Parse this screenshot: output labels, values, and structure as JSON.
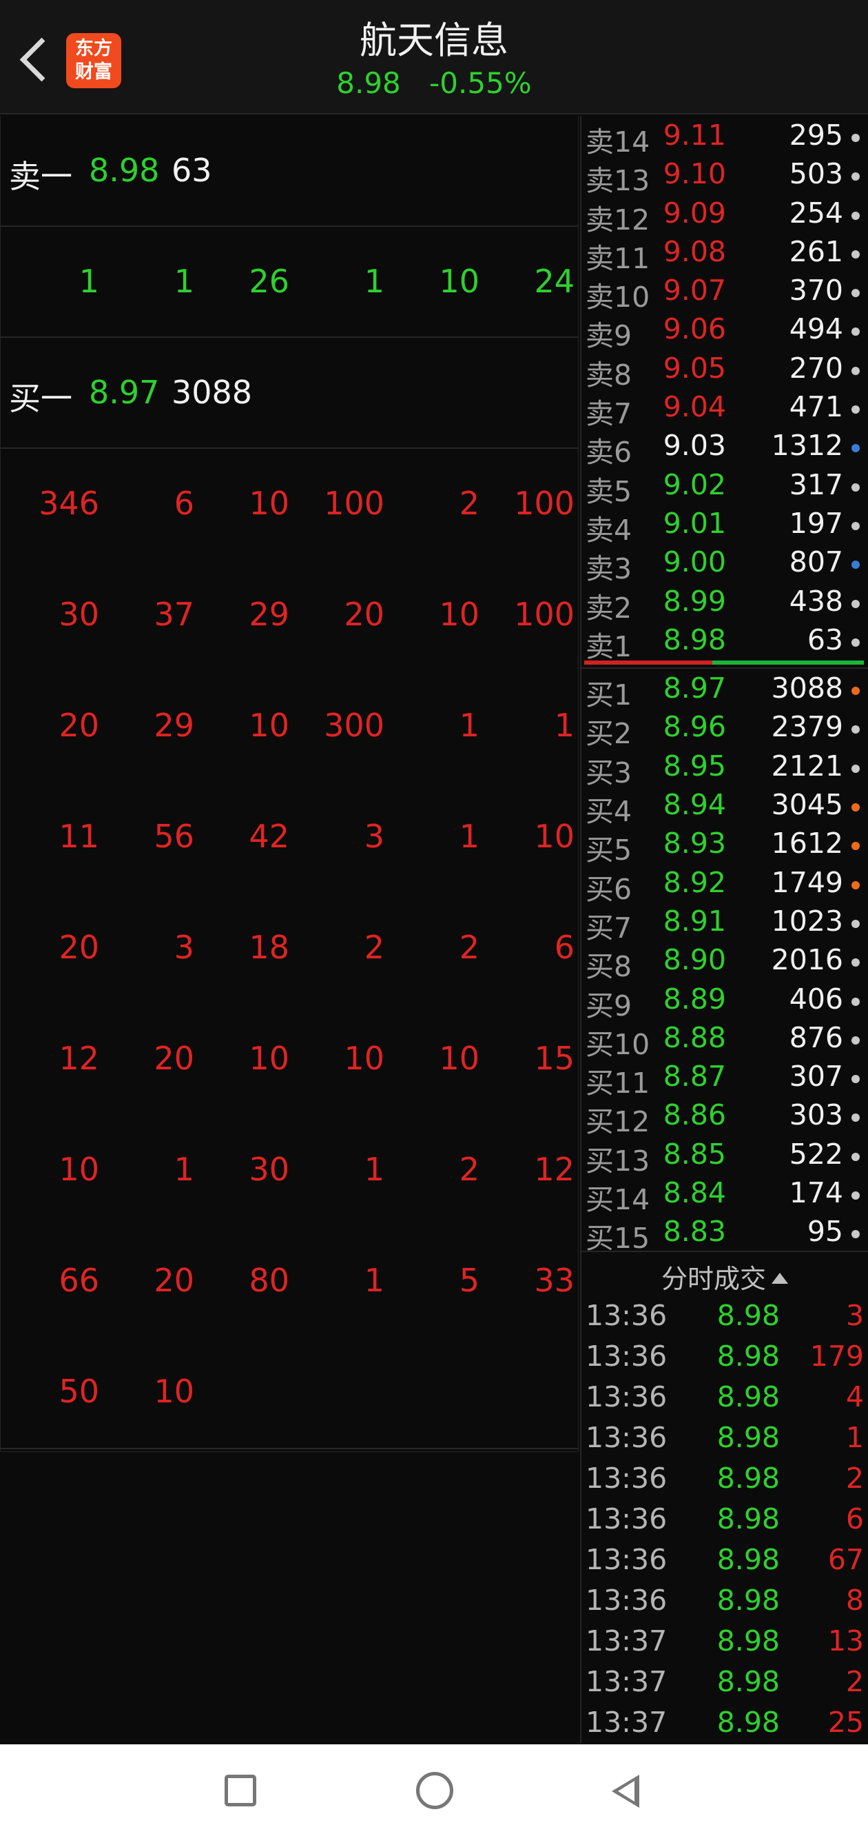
{
  "header": {
    "app_logo_text": "东方财富",
    "title": "航天信息",
    "price": "8.98",
    "change_pct": "-0.55%"
  },
  "order_book": {
    "ask1": {
      "label": "卖一",
      "price": "8.98",
      "volume": "63"
    },
    "ask_queue": [
      "1",
      "1",
      "26",
      "1",
      "10",
      "24"
    ],
    "bid1": {
      "label": "买一",
      "price": "8.97",
      "volume": "3088"
    },
    "bid_queue": [
      [
        "346",
        "6",
        "10",
        "100",
        "2",
        "100"
      ],
      [
        "30",
        "37",
        "29",
        "20",
        "10",
        "100"
      ],
      [
        "20",
        "29",
        "10",
        "300",
        "1",
        "1"
      ],
      [
        "11",
        "56",
        "42",
        "3",
        "1",
        "10"
      ],
      [
        "20",
        "3",
        "18",
        "2",
        "2",
        "6"
      ],
      [
        "12",
        "20",
        "10",
        "10",
        "10",
        "15"
      ],
      [
        "10",
        "1",
        "30",
        "1",
        "2",
        "12"
      ],
      [
        "66",
        "20",
        "80",
        "1",
        "5",
        "33"
      ],
      [
        "50",
        "10"
      ]
    ]
  },
  "depth": {
    "asks": [
      {
        "label": "卖14",
        "price": "9.11",
        "volume": "295",
        "color": "red",
        "dot": "#c9c9c9"
      },
      {
        "label": "卖13",
        "price": "9.10",
        "volume": "503",
        "color": "red",
        "dot": "#c9c9c9"
      },
      {
        "label": "卖12",
        "price": "9.09",
        "volume": "254",
        "color": "red",
        "dot": "#c9c9c9"
      },
      {
        "label": "卖11",
        "price": "9.08",
        "volume": "261",
        "color": "red",
        "dot": "#c9c9c9"
      },
      {
        "label": "卖10",
        "price": "9.07",
        "volume": "370",
        "color": "red",
        "dot": "#c9c9c9"
      },
      {
        "label": "卖9",
        "price": "9.06",
        "volume": "494",
        "color": "red",
        "dot": "#c9c9c9"
      },
      {
        "label": "卖8",
        "price": "9.05",
        "volume": "270",
        "color": "red",
        "dot": "#c9c9c9"
      },
      {
        "label": "卖7",
        "price": "9.04",
        "volume": "471",
        "color": "red",
        "dot": "#c9c9c9"
      },
      {
        "label": "卖6",
        "price": "9.03",
        "volume": "1312",
        "color": "white",
        "dot": "#3a7bd5"
      },
      {
        "label": "卖5",
        "price": "9.02",
        "volume": "317",
        "color": "green",
        "dot": "#c9c9c9"
      },
      {
        "label": "卖4",
        "price": "9.01",
        "volume": "197",
        "color": "green",
        "dot": "#c9c9c9"
      },
      {
        "label": "卖3",
        "price": "9.00",
        "volume": "807",
        "color": "green",
        "dot": "#3a7bd5"
      },
      {
        "label": "卖2",
        "price": "8.99",
        "volume": "438",
        "color": "green",
        "dot": "#c9c9c9"
      },
      {
        "label": "卖1",
        "price": "8.98",
        "volume": "63",
        "color": "green",
        "dot": "#c9c9c9"
      }
    ],
    "bids": [
      {
        "label": "买1",
        "price": "8.97",
        "volume": "3088",
        "color": "green",
        "dot": "#f06a1c"
      },
      {
        "label": "买2",
        "price": "8.96",
        "volume": "2379",
        "color": "green",
        "dot": "#c9c9c9"
      },
      {
        "label": "买3",
        "price": "8.95",
        "volume": "2121",
        "color": "green",
        "dot": "#c9c9c9"
      },
      {
        "label": "买4",
        "price": "8.94",
        "volume": "3045",
        "color": "green",
        "dot": "#f06a1c"
      },
      {
        "label": "买5",
        "price": "8.93",
        "volume": "1612",
        "color": "green",
        "dot": "#f06a1c"
      },
      {
        "label": "买6",
        "price": "8.92",
        "volume": "1749",
        "color": "green",
        "dot": "#f06a1c"
      },
      {
        "label": "买7",
        "price": "8.91",
        "volume": "1023",
        "color": "green",
        "dot": "#c9c9c9"
      },
      {
        "label": "买8",
        "price": "8.90",
        "volume": "2016",
        "color": "green",
        "dot": "#c9c9c9"
      },
      {
        "label": "买9",
        "price": "8.89",
        "volume": "406",
        "color": "green",
        "dot": "#c9c9c9"
      },
      {
        "label": "买10",
        "price": "8.88",
        "volume": "876",
        "color": "green",
        "dot": "#c9c9c9"
      },
      {
        "label": "买11",
        "price": "8.87",
        "volume": "307",
        "color": "green",
        "dot": "#c9c9c9"
      },
      {
        "label": "买12",
        "price": "8.86",
        "volume": "303",
        "color": "green",
        "dot": "#c9c9c9"
      },
      {
        "label": "买13",
        "price": "8.85",
        "volume": "522",
        "color": "green",
        "dot": "#c9c9c9"
      },
      {
        "label": "买14",
        "price": "8.84",
        "volume": "174",
        "color": "green",
        "dot": "#c9c9c9"
      },
      {
        "label": "买15",
        "price": "8.83",
        "volume": "95",
        "color": "green",
        "dot": "#c9c9c9"
      }
    ]
  },
  "ticks": {
    "header": "分时成交",
    "rows": [
      {
        "time": "13:36",
        "price": "8.98",
        "volume": "3"
      },
      {
        "time": "13:36",
        "price": "8.98",
        "volume": "179"
      },
      {
        "time": "13:36",
        "price": "8.98",
        "volume": "4"
      },
      {
        "time": "13:36",
        "price": "8.98",
        "volume": "1"
      },
      {
        "time": "13:36",
        "price": "8.98",
        "volume": "2"
      },
      {
        "time": "13:36",
        "price": "8.98",
        "volume": "6"
      },
      {
        "time": "13:36",
        "price": "8.98",
        "volume": "67"
      },
      {
        "time": "13:36",
        "price": "8.98",
        "volume": "8"
      },
      {
        "time": "13:37",
        "price": "8.98",
        "volume": "13"
      },
      {
        "time": "13:37",
        "price": "8.98",
        "volume": "2"
      },
      {
        "time": "13:37",
        "price": "8.98",
        "volume": "25"
      }
    ]
  },
  "colors": {
    "up": "#e02424",
    "down": "#2ed12e",
    "brand": "#f04a1e"
  }
}
